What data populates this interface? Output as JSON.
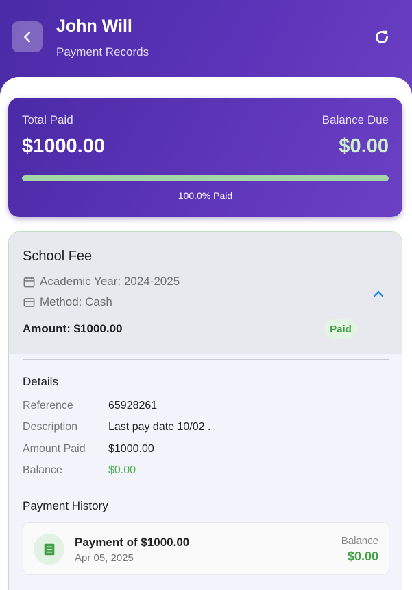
{
  "header": {
    "title": "John Will",
    "subtitle": "Payment Records",
    "back_icon": "chevron-left-icon",
    "refresh_icon": "refresh-icon"
  },
  "summary": {
    "total_paid_label": "Total Paid",
    "total_paid_value": "$1000.00",
    "balance_due_label": "Balance Due",
    "balance_due_value": "$0.00",
    "progress_fraction": 1.0,
    "progress_text": "100.0% Paid"
  },
  "fee": {
    "title": "School Fee",
    "academic_year": "Academic Year: 2024-2025",
    "method": "Method: Cash",
    "amount": "Amount: $1000.00",
    "status": "Paid",
    "details_title": "Details",
    "details": [
      {
        "label": "Reference",
        "value": "65928261"
      },
      {
        "label": "Description",
        "value": "Last pay date 10/02 ."
      },
      {
        "label": "Amount Paid",
        "value": "$1000.00"
      },
      {
        "label": "Balance",
        "value": "$0.00"
      }
    ],
    "history_title": "Payment History",
    "history": [
      {
        "title": "Payment of $1000.00",
        "date": "Apr 05, 2025",
        "balance_label": "Balance",
        "balance_value": "$0.00"
      }
    ]
  },
  "colors": {
    "primary": "#5b33b8",
    "success": "#43a047",
    "accent_blue": "#1e88e5"
  }
}
